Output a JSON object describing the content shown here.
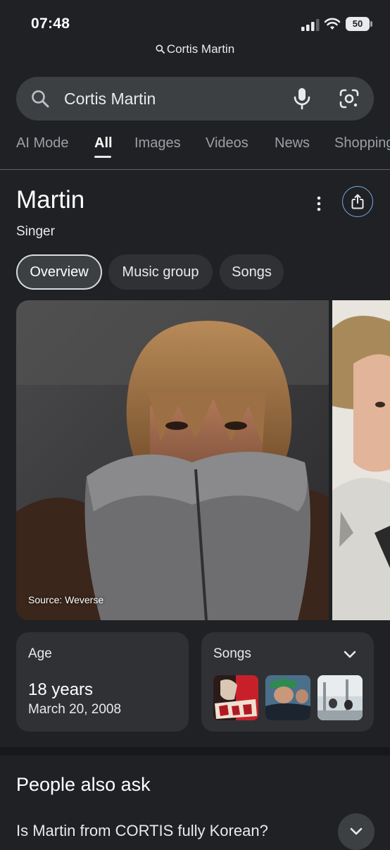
{
  "status_bar": {
    "time": "07:48",
    "battery": "50"
  },
  "url_bar": {
    "query": "Cortis Martin"
  },
  "search": {
    "value": "Cortis Martin"
  },
  "tabs": [
    {
      "label": "AI Mode"
    },
    {
      "label": "All",
      "active": true
    },
    {
      "label": "Images"
    },
    {
      "label": "Videos"
    },
    {
      "label": "News"
    },
    {
      "label": "Shopping"
    }
  ],
  "knowledge_panel": {
    "title": "Martin",
    "subtitle": "Singer",
    "chips": [
      {
        "label": "Overview",
        "selected": true
      },
      {
        "label": "Music group"
      },
      {
        "label": "Songs"
      }
    ],
    "photo_source": "Source: Weverse",
    "age": {
      "label": "Age",
      "value": "18 years",
      "birth_date": "March 20, 2008"
    },
    "songs": {
      "label": "Songs"
    }
  },
  "people_also_ask": {
    "title": "People also ask",
    "questions": [
      "Is Martin from CORTIS fully Korean?"
    ]
  },
  "colors": {
    "background": "#202124",
    "surface": "#303134",
    "search_box": "#3c4043",
    "share_outline": "#7aa9e8"
  }
}
